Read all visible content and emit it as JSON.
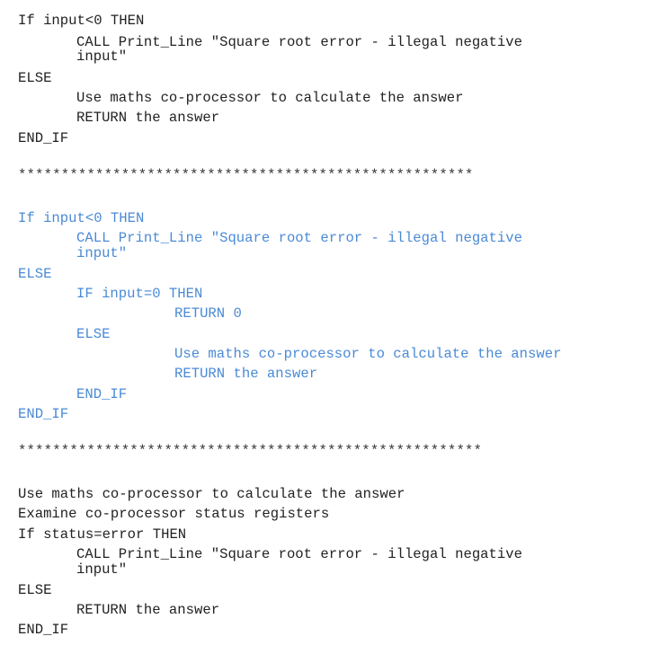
{
  "block1": {
    "lines": [
      "If input<0 THEN",
      "CALL Print_Line \"Square root error - illegal negative",
      "input\"",
      "ELSE",
      "Use maths co-processor to calculate the answer",
      "RETURN the answer",
      "END_IF"
    ]
  },
  "separator1": "*****************************************************",
  "block2": {
    "color": "#4a8ad6",
    "lines": [
      "If input<0 THEN",
      "CALL Print_Line \"Square root error - illegal negative",
      "input\"",
      "ELSE",
      "IF input=0 THEN",
      "RETURN 0",
      "ELSE",
      "Use maths co-processor to calculate the answer",
      "RETURN the answer",
      "END_IF",
      "END_IF"
    ]
  },
  "separator2": "******************************************************",
  "block3": {
    "lines": [
      "Use maths co-processor to calculate the answer",
      "Examine co-processor status registers",
      "If status=error THEN",
      "CALL Print_Line \"Square root error - illegal negative",
      "input\"",
      "ELSE",
      "RETURN the answer",
      "END_IF"
    ]
  }
}
